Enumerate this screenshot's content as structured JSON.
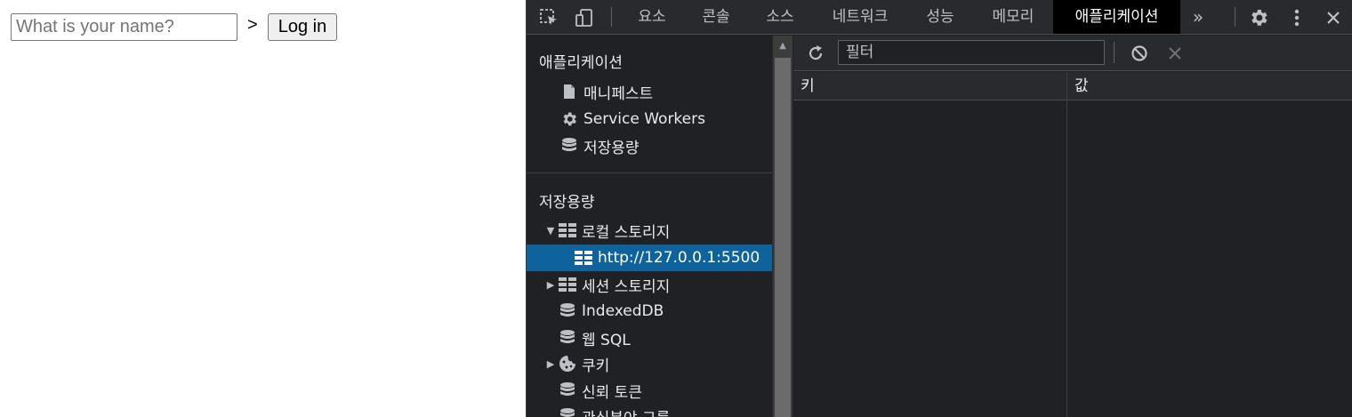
{
  "page": {
    "name_input_placeholder": "What is your name?",
    "separator": ">",
    "login_label": "Log in"
  },
  "devtools": {
    "tabs": [
      "요소",
      "콘솔",
      "소스",
      "네트워크",
      "성능",
      "메모리",
      "애플리케이션"
    ],
    "active_tab": "애플리케이션",
    "more_tabs_label": "»",
    "sidebar": {
      "app_section_title": "애플리케이션",
      "app_items": [
        {
          "label": "매니페스트",
          "icon": "file-icon"
        },
        {
          "label": "Service Workers",
          "icon": "gear-icon"
        },
        {
          "label": "저장용량",
          "icon": "database-icon"
        }
      ],
      "storage_section_title": "저장용량",
      "storage_items": [
        {
          "label": "로컬 스토리지",
          "icon": "table-icon",
          "expanded": true
        },
        {
          "label": "http://127.0.0.1:5500",
          "icon": "table-icon",
          "selected": true
        },
        {
          "label": "세션 스토리지",
          "icon": "table-icon",
          "expanded": false
        },
        {
          "label": "IndexedDB",
          "icon": "database-icon"
        },
        {
          "label": "웹 SQL",
          "icon": "database-icon"
        },
        {
          "label": "쿠키",
          "icon": "cookie-icon",
          "expanded": false
        },
        {
          "label": "신뢰 토큰",
          "icon": "database-icon"
        },
        {
          "label": "관심분야 그룹",
          "icon": "database-icon"
        }
      ]
    },
    "panel": {
      "filter_placeholder": "필터",
      "columns": [
        "키",
        "값"
      ]
    },
    "colors": {
      "background": "#202124",
      "toolbar": "#292a2d",
      "selected": "#0e639c",
      "active_tab_bg": "#000000",
      "text": "#e8eaed"
    }
  }
}
